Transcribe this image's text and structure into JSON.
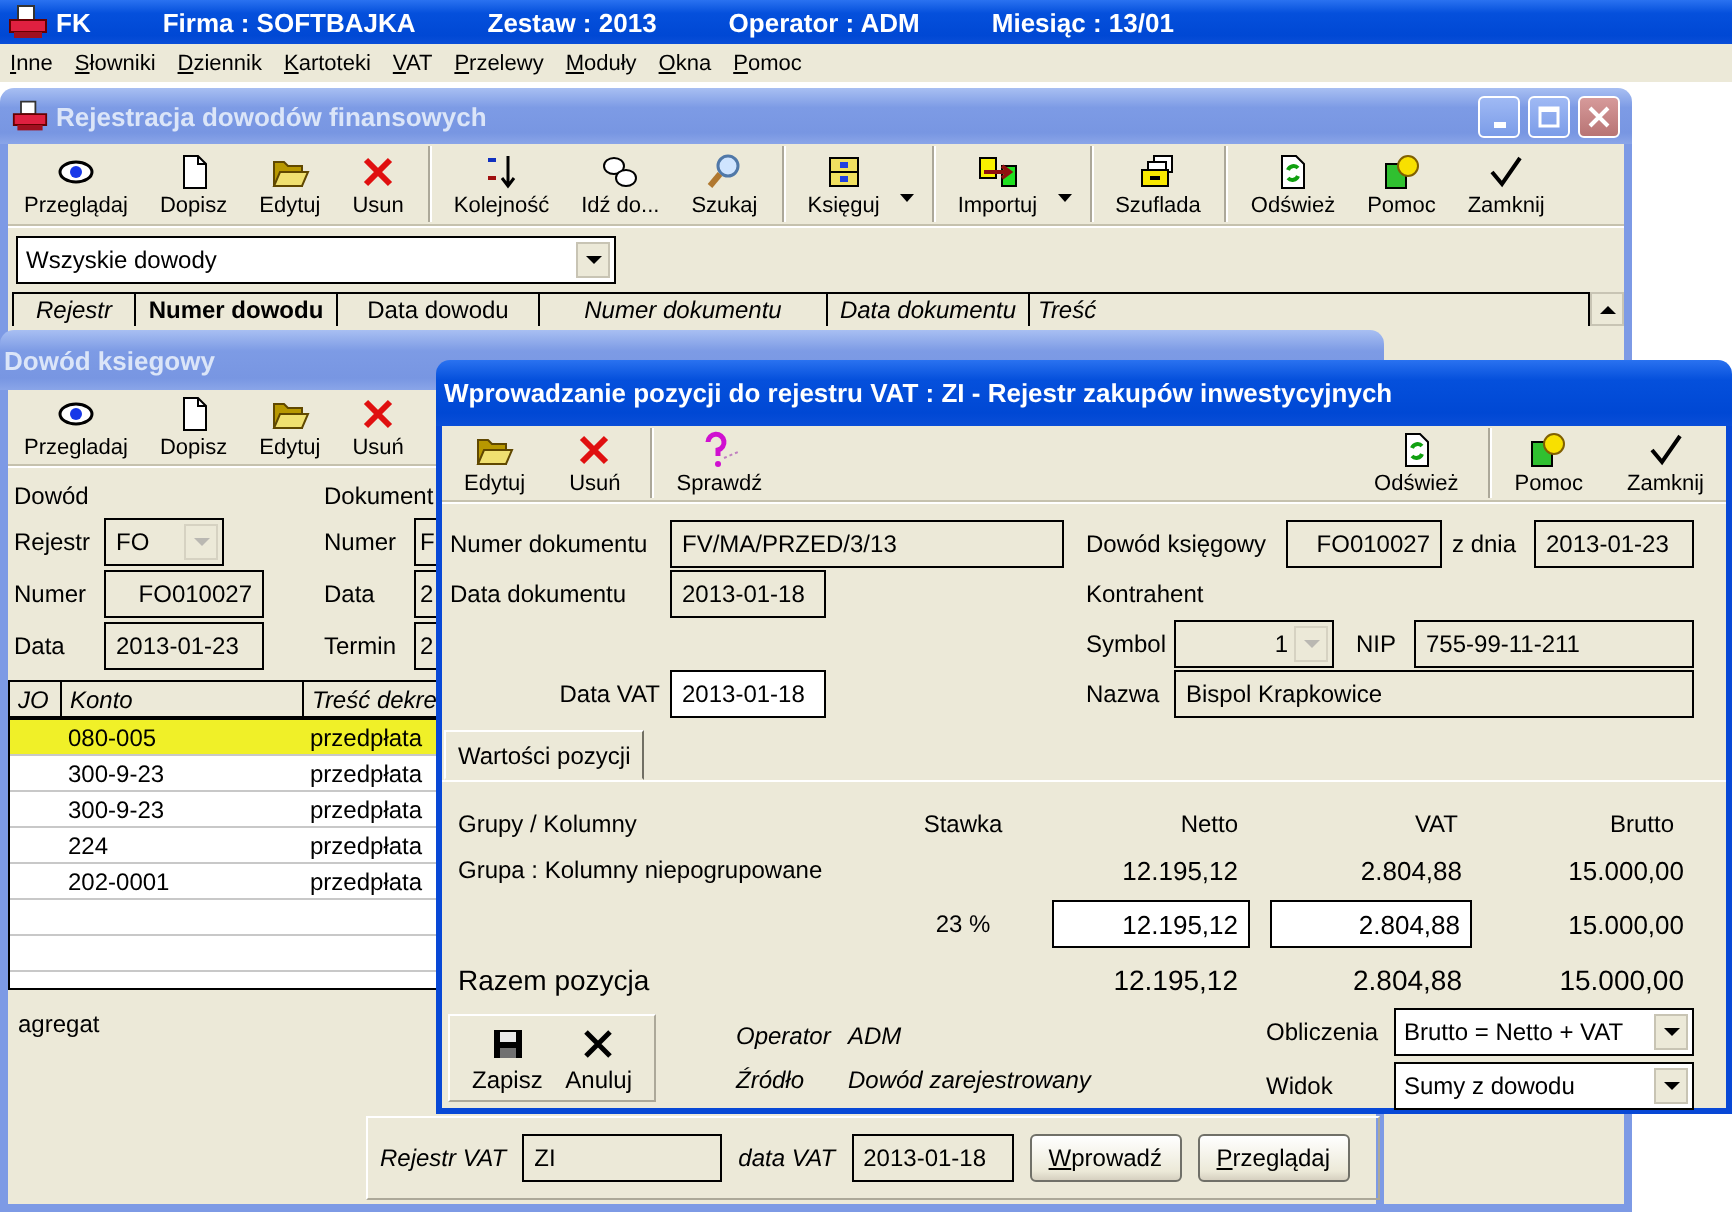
{
  "app_title_bar": {
    "app_name": "FK",
    "active": true,
    "items": [
      "Firma : SOFTBAJKA",
      "Zestaw : 2013",
      "Operator : ADM",
      "Miesiąc : 13/01"
    ]
  },
  "menu": [
    "Inne",
    "Słowniki",
    "Dziennik",
    "Kartoteki",
    "VAT",
    "Przelewy",
    "Moduły",
    "Okna",
    "Pomoc"
  ],
  "registry_window": {
    "title": "Rejestracja dowodów finansowych",
    "active": false,
    "toolbar": [
      {
        "label": "Przeglądaj",
        "group_start": false,
        "dropdown": false
      },
      {
        "label": "Dopisz",
        "group_start": false,
        "dropdown": false
      },
      {
        "label": "Edytuj",
        "group_start": false,
        "dropdown": false
      },
      {
        "label": "Usun",
        "group_start": false,
        "dropdown": false
      },
      {
        "label": "Kolejność",
        "group_start": true,
        "dropdown": false
      },
      {
        "label": "Idź do...",
        "group_start": false,
        "dropdown": false
      },
      {
        "label": "Szukaj",
        "group_start": false,
        "dropdown": false
      },
      {
        "label": "Księguj",
        "group_start": true,
        "dropdown": true
      },
      {
        "label": "Importuj",
        "group_start": true,
        "dropdown": true
      },
      {
        "label": "Szuflada",
        "group_start": true,
        "dropdown": false
      },
      {
        "label": "Odśwież",
        "group_start": true,
        "dropdown": false
      },
      {
        "label": "Pomoc",
        "group_start": false,
        "dropdown": false
      },
      {
        "label": "Zamknij",
        "group_start": false,
        "dropdown": false
      }
    ],
    "filter": {
      "value": "Wszyskie dowody"
    },
    "columns": [
      {
        "label": "Rejestr",
        "italic": true,
        "bold": false
      },
      {
        "label": "Numer dowodu",
        "italic": false,
        "bold": true
      },
      {
        "label": "Data dowodu",
        "italic": false,
        "bold": false
      },
      {
        "label": "Numer dokumentu",
        "italic": true,
        "bold": false
      },
      {
        "label": "Data dokumentu",
        "italic": true,
        "bold": false
      },
      {
        "label": "Treść",
        "italic": true,
        "bold": false
      }
    ]
  },
  "document_window": {
    "title": "Dowód ksiegowy",
    "active": false,
    "toolbar": [
      "Przegladaj",
      "Dopisz",
      "Edytuj",
      "Usuń"
    ],
    "dowod": {
      "heading": "Dowód",
      "fields": [
        {
          "label": "Rejestr",
          "value": "FO",
          "kind": "dropdown"
        },
        {
          "label": "Numer",
          "value": "FO010027",
          "kind": "right"
        },
        {
          "label": "Data",
          "value": "2013-01-23",
          "kind": "text"
        }
      ]
    },
    "dokument": {
      "heading": "Dokument",
      "fields": [
        {
          "label": "Numer",
          "value": "F"
        },
        {
          "label": "Data",
          "value": "2"
        },
        {
          "label": "Termin",
          "value": "2"
        }
      ]
    },
    "columns": [
      {
        "label": "JO"
      },
      {
        "label": "Konto"
      },
      {
        "label": "Treść dekre"
      }
    ],
    "entries": [
      {
        "konto": "080-005",
        "tresc": "przedpłata",
        "selected": true
      },
      {
        "konto": "300-9-23",
        "tresc": "przedpłata",
        "selected": false
      },
      {
        "konto": "300-9-23",
        "tresc": "przedpłata",
        "selected": false
      },
      {
        "konto": "224",
        "tresc": "przedpłata",
        "selected": false
      },
      {
        "konto": "202-0001",
        "tresc": "przedpłata",
        "selected": false
      }
    ],
    "note": "agregat",
    "vat_bar": {
      "register": {
        "label": "Rejestr VAT",
        "value": "ZI"
      },
      "date": {
        "label": "data VAT",
        "value": "2013-01-18"
      },
      "buttons": [
        "Wprowadź",
        "Przeglądaj"
      ]
    }
  },
  "vat_dialog": {
    "title": "Wprowadzanie pozycji do rejestru VAT : ZI - Rejestr zakupów inwestycyjnych",
    "active": true,
    "toolbar_left": [
      {
        "label": "Edytuj",
        "group_start": false
      },
      {
        "label": "Usuń",
        "group_start": false
      },
      {
        "label": "Sprawdź",
        "group_start": true
      }
    ],
    "toolbar_right": [
      {
        "label": "Odśwież",
        "group_start": false
      },
      {
        "label": "Pomoc",
        "group_start": true
      },
      {
        "label": "Zamknij",
        "group_start": false
      }
    ],
    "document_number": {
      "label": "Numer dokumentu",
      "value": "FV/MA/PRZED/3/13"
    },
    "document_date": {
      "label": "Data dokumentu",
      "value": "2013-01-18"
    },
    "vat_date": {
      "label": "Data VAT",
      "value": "2013-01-18"
    },
    "voucher": {
      "label": "Dowód księgowy",
      "value": "FO010027"
    },
    "voucher_date": {
      "label": "z dnia",
      "value": "2013-01-23"
    },
    "contractor": {
      "heading": "Kontrahent",
      "symbol": {
        "label": "Symbol",
        "value": "1"
      },
      "nip": {
        "label": "NIP",
        "value": "755-99-11-211"
      },
      "name": {
        "label": "Nazwa",
        "value": "Bispol Krapkowice"
      }
    },
    "tabs": [
      {
        "label": "Wartości pozycji",
        "selected": true
      }
    ],
    "values": {
      "headers": [
        "Grupy / Kolumny",
        "Stawka",
        "Netto",
        "VAT",
        "Brutto"
      ],
      "group": {
        "label": "Grupa : Kolumny niepogrupowane",
        "netto": "12.195,12",
        "vat": "2.804,88",
        "brutto": "15.000,00"
      },
      "rate": {
        "stawka": "23 %",
        "netto": "12.195,12",
        "vat": "2.804,88",
        "brutto": "15.000,00"
      },
      "total": {
        "label": "Razem pozycja",
        "netto": "12.195,12",
        "vat": "2.804,88",
        "brutto": "15.000,00"
      }
    },
    "buttons": [
      "Zapisz",
      "Anuluj"
    ],
    "info": [
      {
        "label": "Operator",
        "value": "ADM"
      },
      {
        "label": "Źródło",
        "value": "Dowód zarejestrowany"
      }
    ],
    "selects": [
      {
        "label": "Obliczenia",
        "value": "Brutto = Netto + VAT"
      },
      {
        "label": "Widok",
        "value": "Sumy z dowodu"
      }
    ]
  }
}
